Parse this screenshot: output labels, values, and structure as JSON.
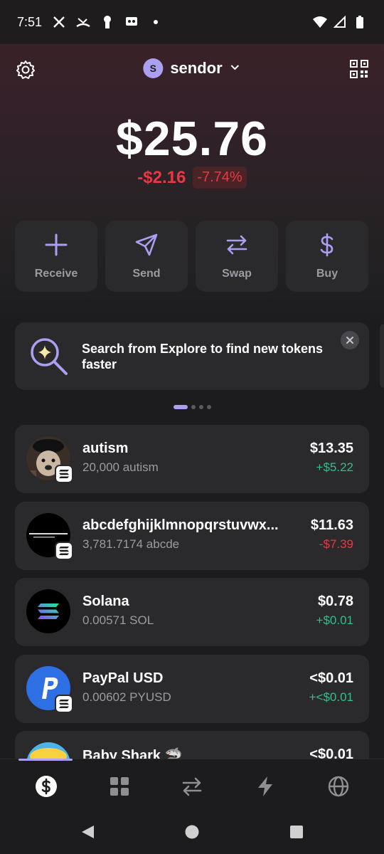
{
  "status_bar": {
    "time": "7:51"
  },
  "header": {
    "account_initial": "S",
    "account_name": "sendor"
  },
  "balance": {
    "total": "$25.76",
    "change_value": "-$2.16",
    "change_percent": "-7.74%"
  },
  "actions": [
    {
      "label": "Receive",
      "icon": "plus-icon"
    },
    {
      "label": "Send",
      "icon": "send-icon"
    },
    {
      "label": "Swap",
      "icon": "swap-icon"
    },
    {
      "label": "Buy",
      "icon": "dollar-icon"
    }
  ],
  "banner": {
    "text": "Search from Explore to find new tokens faster"
  },
  "tokens": [
    {
      "name": "autism",
      "amount": "20,000 autism",
      "value": "$13.35",
      "change": "+$5.22",
      "trend": "pos"
    },
    {
      "name": "abcdefghijklmnopqrstuvwx...",
      "amount": "3,781.7174 abcde",
      "value": "$11.63",
      "change": "-$7.39",
      "trend": "neg"
    },
    {
      "name": "Solana",
      "amount": "0.00571 SOL",
      "value": "$0.78",
      "change": "+$0.01",
      "trend": "pos"
    },
    {
      "name": "PayPal USD",
      "amount": "0.00602 PYUSD",
      "value": "<$0.01",
      "change": "+<$0.01",
      "trend": "pos"
    },
    {
      "name": "Baby Shark 🦈",
      "amount": "",
      "value": "<$0.01",
      "change": "",
      "trend": "pos"
    }
  ],
  "colors": {
    "accent": "#ab9ff2",
    "positive": "#2ec08b",
    "negative": "#eb3742",
    "card": "#2a2a2d"
  }
}
